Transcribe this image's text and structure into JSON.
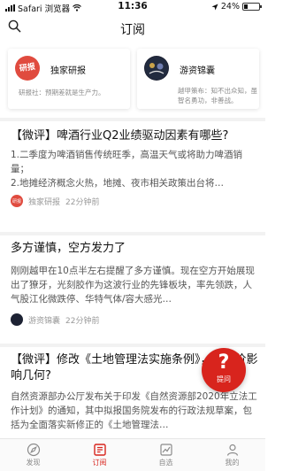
{
  "status_bar": {
    "carrier": "Safari 浏览器",
    "time": "11:36",
    "battery": "24%",
    "battery_level": 0.24
  },
  "nav": {
    "title": "订阅",
    "search_icon": "search-icon"
  },
  "subscriptions": [
    {
      "logo": "研报",
      "name": "独家研报",
      "desc": "研报社：预期差就是生产力。"
    },
    {
      "logo": "越甲",
      "name": "游资锦囊",
      "desc": "越甲策布：知不出众知，虽智名勇功，非善战。"
    }
  ],
  "feed": [
    {
      "title": "【微评】啤酒行业Q2业绩驱动因素有哪些?",
      "body": "1.二季度为啤酒销售传统旺季，高温天气或将助力啤酒销量；\n2.地摊经济概念火热，地摊、夜市相关政策出台将…",
      "source": "独家研报",
      "time": "22分钟前"
    },
    {
      "title": "多方谨慎，空方发力了",
      "body": "刚刚越甲在10点半左右提醒了多方谨慎。现在空方开始展现出了獠牙，光刻胶作为这波行业的先锋板块，率先领跌，人气股江化微跌停、华特气体/容大感光…",
      "source": "游资锦囊",
      "time": "22分钟前"
    },
    {
      "title": "【微评】修改《土地管理法实施条例》，对房价影响几何?",
      "body": "自然资源部办公厅发布关于印发《自然资源部2020年立法工作计划》的通知，其中拟报国务院发布的行政法规草案，包括为全面落实新修正的《土地管理法…",
      "source": "",
      "time": ""
    }
  ],
  "ask_button": {
    "label": "提问",
    "symbol": "?"
  },
  "tabbar": [
    {
      "label": "发现",
      "icon": "compass-icon",
      "active": false
    },
    {
      "label": "订阅",
      "icon": "subscription-icon",
      "active": true
    },
    {
      "label": "自选",
      "icon": "watchlist-icon",
      "active": false
    },
    {
      "label": "我的",
      "icon": "user-icon",
      "active": false
    }
  ],
  "colors": {
    "accent": "#d8241d",
    "text": "#111111",
    "muted": "#999999"
  }
}
